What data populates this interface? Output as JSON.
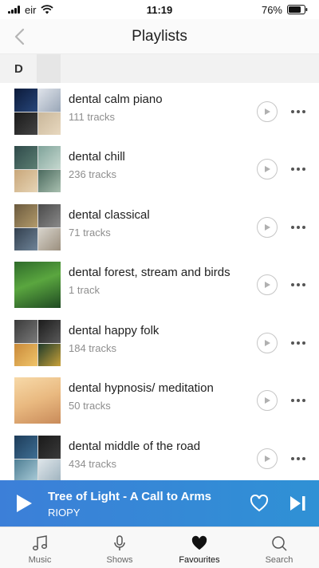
{
  "status": {
    "carrier": "eir",
    "time": "11:19",
    "battery": "76%"
  },
  "header": {
    "title": "Playlists"
  },
  "section": {
    "letter": "D"
  },
  "playlists": [
    {
      "title": "dental calm piano",
      "tracks": "111 tracks"
    },
    {
      "title": "dental chill",
      "tracks": "236 tracks"
    },
    {
      "title": "dental classical",
      "tracks": "71 tracks"
    },
    {
      "title": "dental forest, stream and birds",
      "tracks": "1 track"
    },
    {
      "title": "dental happy folk",
      "tracks": "184 tracks"
    },
    {
      "title": "dental hypnosis/ meditation",
      "tracks": "50 tracks"
    },
    {
      "title": "dental middle of the road",
      "tracks": "434 tracks"
    }
  ],
  "now_playing": {
    "title": "Tree of Light - A Call to Arms",
    "artist": "RIOPY"
  },
  "tabs": [
    {
      "label": "Music",
      "icon": "music-note-icon"
    },
    {
      "label": "Shows",
      "icon": "microphone-icon"
    },
    {
      "label": "Favourites",
      "icon": "heart-icon"
    },
    {
      "label": "Search",
      "icon": "search-icon"
    }
  ],
  "colors": {
    "accent": "#3c7fd8",
    "now_playing_bg": "#2f91d5"
  }
}
